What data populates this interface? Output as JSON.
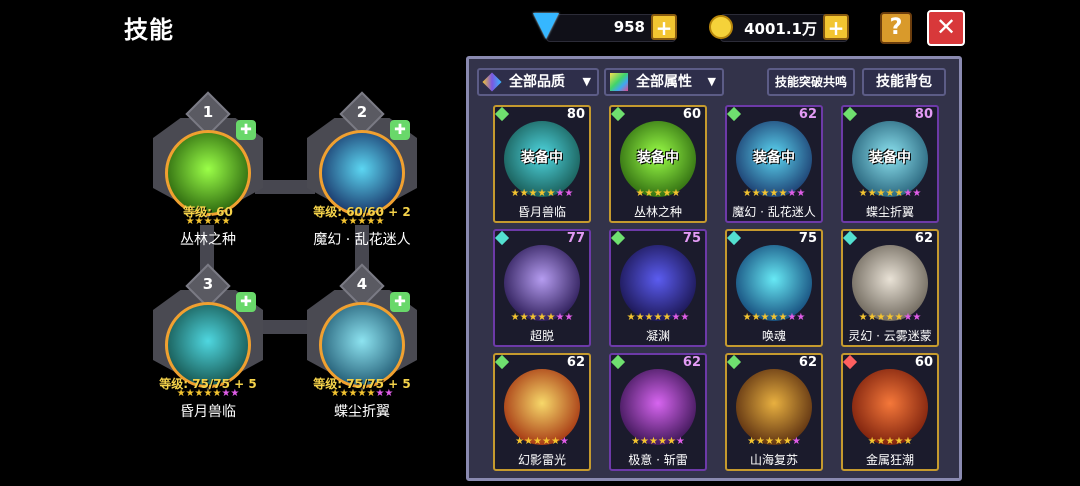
{
  "header": {
    "title": "技能"
  },
  "currency": {
    "gems": "958",
    "gold": "4001.1万",
    "plus": "+"
  },
  "buttons": {
    "help": "?",
    "close": "✕"
  },
  "equipped": [
    {
      "num": "1",
      "name": "丛林之种",
      "level": "等级: 60",
      "stars": "★★★★★",
      "pstars": "",
      "orb": [
        "#9bff48",
        "#2f6b10"
      ]
    },
    {
      "num": "2",
      "name": "魔幻 · 乱花迷人",
      "level": "等级: 60/60 + 2",
      "stars": "★★★★★",
      "pstars": "",
      "orb": [
        "#5cd6f2",
        "#1b3b6e"
      ]
    },
    {
      "num": "3",
      "name": "昏月兽临",
      "level": "等级: 75/75 + 5",
      "stars": "★★★★★",
      "pstars": "★★",
      "orb": [
        "#4fd7e0",
        "#185a55"
      ]
    },
    {
      "num": "4",
      "name": "蝶尘折翼",
      "level": "等级: 75/75 + 5",
      "stars": "★★★★★",
      "pstars": "★★",
      "orb": [
        "#8de3f0",
        "#27627a"
      ]
    }
  ],
  "filters": {
    "quality": "全部品质",
    "attribute": "全部属性",
    "breakthrough": "技能突破共鸣",
    "backpack": "技能背包",
    "arrow": "▼"
  },
  "skills": [
    {
      "name": "昏月兽临",
      "level": "80",
      "equipped": "装备中",
      "stars": "★★★★★",
      "pstars": "★★",
      "border": "gold",
      "tag": "",
      "orb": [
        "#4fd7e0",
        "#185a55"
      ]
    },
    {
      "name": "丛林之种",
      "level": "60",
      "equipped": "装备中",
      "stars": "★★★★★",
      "pstars": "",
      "border": "gold",
      "tag": "",
      "orb": [
        "#9bff48",
        "#2f6b10"
      ]
    },
    {
      "name": "魔幻 · 乱花迷人",
      "level": "62",
      "equipped": "装备中",
      "stars": "★★★★★",
      "pstars": "★★",
      "border": "purple",
      "tag": "",
      "orb": [
        "#5cd6f2",
        "#1b3b6e"
      ]
    },
    {
      "name": "蝶尘折翼",
      "level": "80",
      "equipped": "装备中",
      "stars": "★★★★★",
      "pstars": "★★",
      "border": "purple",
      "tag": "",
      "orb": [
        "#8de3f0",
        "#27627a"
      ]
    },
    {
      "name": "超脱",
      "level": "77",
      "equipped": "",
      "stars": "★★★★★",
      "pstars": "★★",
      "border": "purple",
      "tag": "",
      "orb": [
        "#b59cf0",
        "#2a1a55"
      ]
    },
    {
      "name": "凝渊",
      "level": "75",
      "equipped": "",
      "stars": "★★★★★",
      "pstars": "★★",
      "border": "purple",
      "tag": "",
      "orb": [
        "#5b5cf0",
        "#1a1550"
      ]
    },
    {
      "name": "唤魂",
      "level": "75",
      "equipped": "",
      "stars": "★★★★★",
      "pstars": "★★",
      "border": "gold",
      "tag": "",
      "orb": [
        "#67e9f5",
        "#14497a"
      ]
    },
    {
      "name": "灵幻 · 云雾迷蒙",
      "level": "62",
      "equipped": "",
      "stars": "★★★★★",
      "pstars": "★★",
      "border": "gold",
      "tag": "",
      "orb": [
        "#e9e2d6",
        "#6c655a"
      ]
    },
    {
      "name": "幻影雷光",
      "level": "62",
      "equipped": "",
      "stars": "★★★★★",
      "pstars": "★",
      "border": "gold",
      "tag": "",
      "orb": [
        "#f7d86a",
        "#a33310"
      ]
    },
    {
      "name": "极意 · 斩雷",
      "level": "62",
      "equipped": "",
      "stars": "★★★★★",
      "pstars": "★",
      "border": "purple",
      "tag": "",
      "orb": [
        "#d765f0",
        "#3c1555"
      ]
    },
    {
      "name": "山海复苏",
      "level": "62",
      "equipped": "",
      "stars": "★★★★★",
      "pstars": "★",
      "border": "gold",
      "tag": "",
      "orb": [
        "#e8b040",
        "#5a2e10"
      ]
    },
    {
      "name": "金属狂潮",
      "level": "60",
      "equipped": "",
      "stars": "★★★★★",
      "pstars": "",
      "border": "gold",
      "tag": "",
      "orb": [
        "#f5783a",
        "#7a1f0c"
      ]
    }
  ]
}
